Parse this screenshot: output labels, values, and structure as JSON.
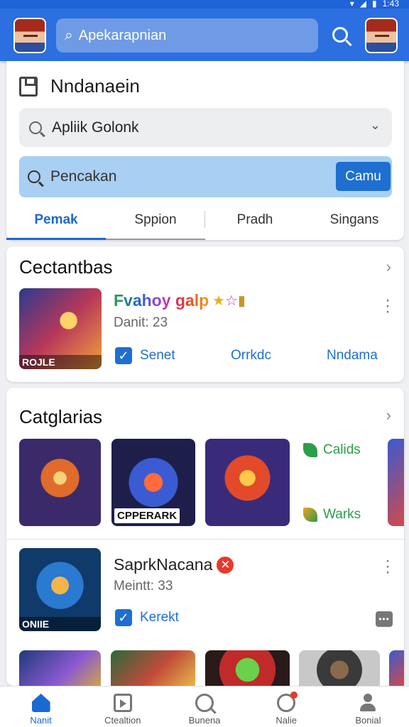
{
  "status_bar": {
    "right_text": "1:43"
  },
  "header": {
    "search_text": "Apekarapnian"
  },
  "panel": {
    "title": "Nndanaein",
    "select_value": "Apliik Golonk",
    "search_text": "Pencakan",
    "camera_button": "Camu",
    "tabs": [
      "Pemak",
      "Sppion",
      "Pradh",
      "Singans"
    ]
  },
  "section_one": {
    "title": "Cectantbas",
    "app": {
      "name": "Fvahoy galp",
      "meta": "Danit: 23",
      "image_label": "ROJLE",
      "actions": [
        "Senet",
        "Orrkdc",
        "Nndama"
      ]
    }
  },
  "section_two": {
    "title": "Catglarias",
    "thumb_label": "CPPERARK",
    "side_links": [
      "Calids",
      "Warks"
    ],
    "app": {
      "name": "SaprkNacana",
      "meta": "Meintt: 33",
      "image_label": "ONIIE",
      "action": "Kerekt"
    }
  },
  "bottom_nav": [
    "Nanit",
    "Ctealtion",
    "Bunena",
    "Nalie",
    "Bonial"
  ],
  "colors": {
    "primary": "#2b6fe0",
    "accent": "#1e6fd0",
    "green": "#2c9d4a",
    "background": "#eef0f3"
  }
}
